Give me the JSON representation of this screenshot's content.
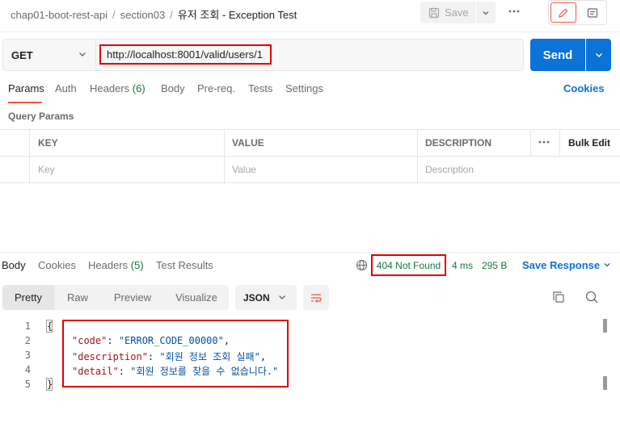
{
  "breadcrumb": {
    "items": [
      "chap01-boot-rest-api",
      "section03"
    ],
    "separator": "/",
    "current": "유저 조회 - Exception Test"
  },
  "toolbar": {
    "save_label": "Save",
    "save_icon": "save-disk-icon",
    "more_icon": "more-horizontal-icon",
    "edit_icon": "pencil-icon",
    "doc_icon": "document-icon"
  },
  "request": {
    "method": "GET",
    "url": "http://localhost:8001/valid/users/1",
    "send_label": "Send",
    "highlight_color": "#e00000",
    "send_color": "#0b72d8"
  },
  "request_tabs": {
    "params": "Params",
    "auth": "Auth",
    "headers": "Headers",
    "headers_count": "(6)",
    "body": "Body",
    "prereq": "Pre-req.",
    "tests": "Tests",
    "settings": "Settings",
    "cookies": "Cookies",
    "active": "Params",
    "active_color": "#f05a3b"
  },
  "query_params": {
    "title": "Query Params",
    "columns": [
      "KEY",
      "VALUE",
      "DESCRIPTION"
    ],
    "bulk_edit": "Bulk Edit",
    "placeholders": [
      "Key",
      "Value",
      "Description"
    ]
  },
  "response": {
    "tabs": {
      "body": "Body",
      "cookies": "Cookies",
      "headers": "Headers",
      "headers_count": "(5)",
      "test_results": "Test Results"
    },
    "status": "404 Not Found",
    "time": "4 ms",
    "size": "295 B",
    "save_response": "Save Response",
    "status_color": "#0f7a3f",
    "views": [
      "Pretty",
      "Raw",
      "Preview",
      "Visualize"
    ],
    "active_view": "Pretty",
    "format": "JSON",
    "line_numbers": [
      "1",
      "2",
      "3",
      "4",
      "5"
    ],
    "open_brace": "{",
    "close_brace": "}",
    "body_lines": [
      {
        "key": "\"code\"",
        "value": "\"ERROR_CODE_00000\"",
        "trail": ","
      },
      {
        "key": "\"description\"",
        "value": "\"회원 정보 조회 실패\"",
        "trail": ","
      },
      {
        "key": "\"detail\"",
        "value": "\"회원 정보를 찾을 수 없습니다.\"",
        "trail": ""
      }
    ]
  }
}
